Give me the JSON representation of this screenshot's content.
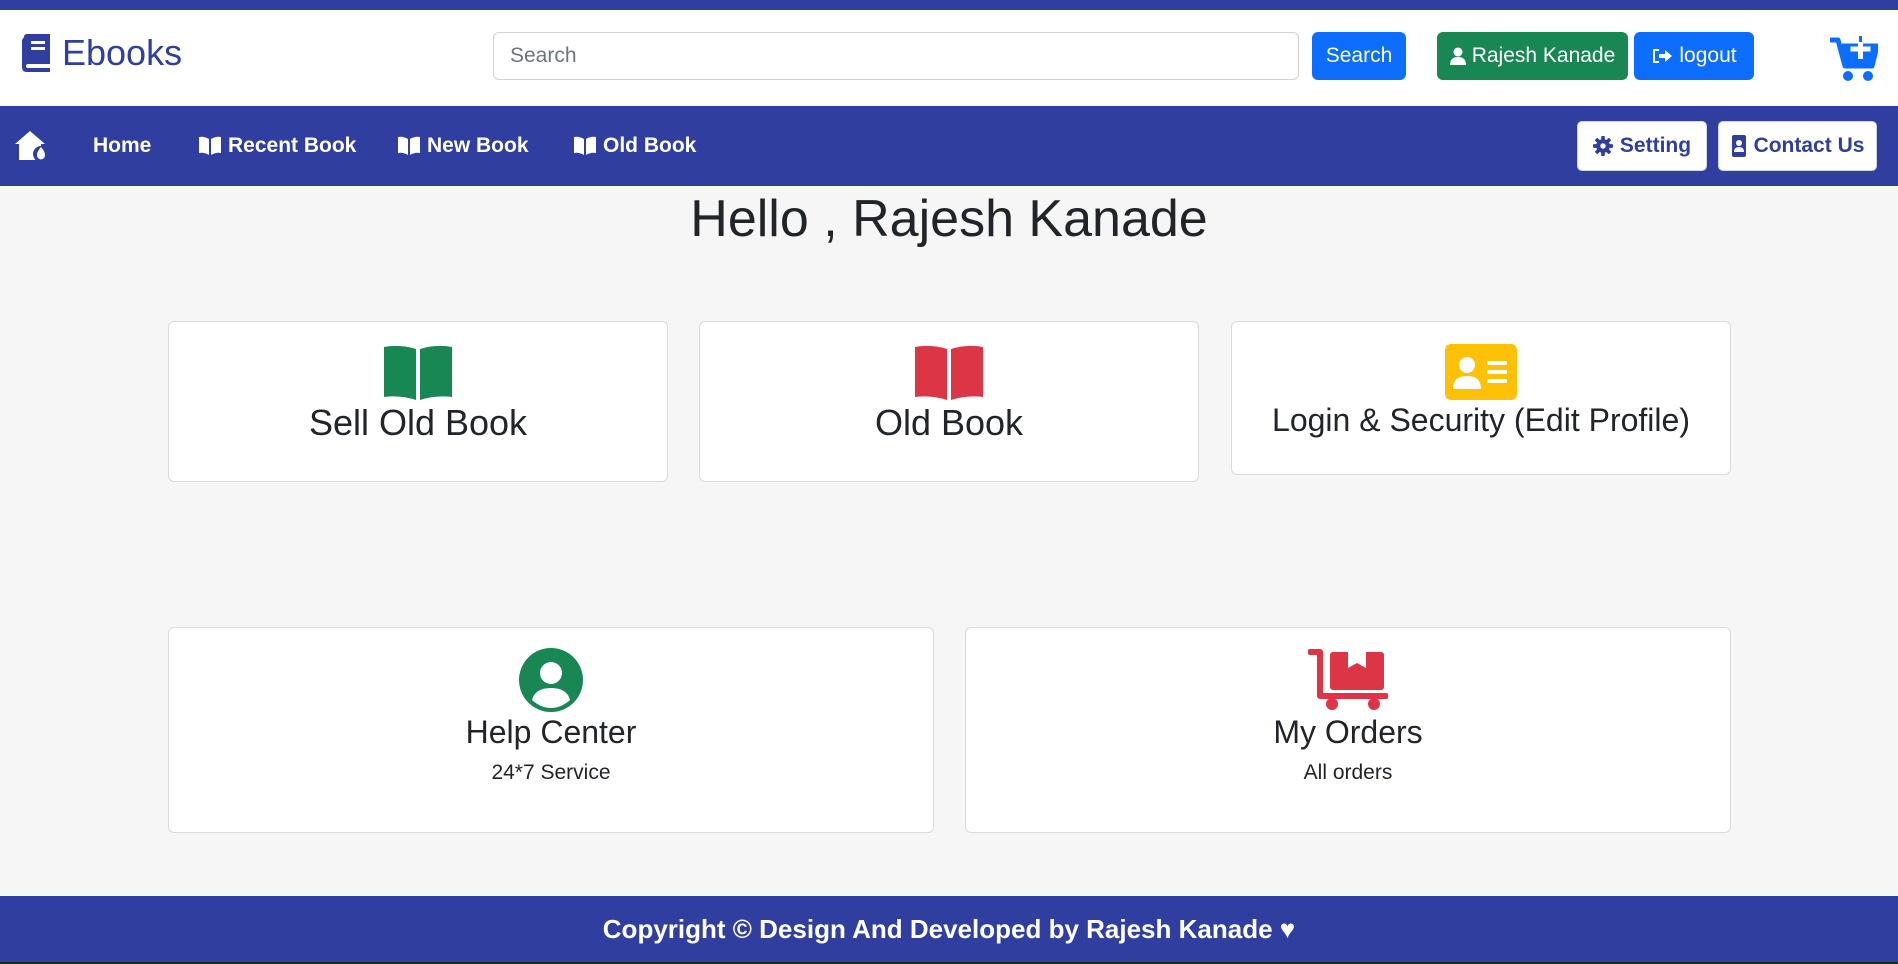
{
  "brand": {
    "name": "Ebooks",
    "icon": "book-icon"
  },
  "search": {
    "placeholder": "Search",
    "value": "",
    "button_label": "Search"
  },
  "user": {
    "name": "Rajesh Kanade",
    "logout_label": "logout"
  },
  "nav": {
    "items": [
      {
        "label": "Home"
      },
      {
        "label": "Recent Book"
      },
      {
        "label": "New Book"
      },
      {
        "label": "Old Book"
      }
    ],
    "setting_label": "Setting",
    "contact_label": "Contact Us"
  },
  "greeting": "Hello , Rajesh Kanade",
  "cards": [
    {
      "title": "Sell Old Book",
      "subtitle": "",
      "icon": "open-book-icon",
      "color": "#198754"
    },
    {
      "title": "Old Book",
      "subtitle": "",
      "icon": "open-book-icon",
      "color": "#dc3545"
    },
    {
      "title": "Login & Security (Edit Profile)",
      "subtitle": "",
      "icon": "id-card-icon",
      "color": "#ffc107"
    },
    {
      "title": "Help Center",
      "subtitle": "24*7 Service",
      "icon": "user-circle-icon",
      "color": "#198754"
    },
    {
      "title": "My Orders",
      "subtitle": "All orders",
      "icon": "dolly-box-icon",
      "color": "#dc3545"
    }
  ],
  "footer": {
    "text": "Copyright © Design And Developed by Rajesh Kanade ♥"
  },
  "colors": {
    "primary": "#303f9f",
    "blue": "#0d6efd",
    "green": "#198754",
    "red": "#dc3545",
    "yellow": "#ffc107"
  }
}
